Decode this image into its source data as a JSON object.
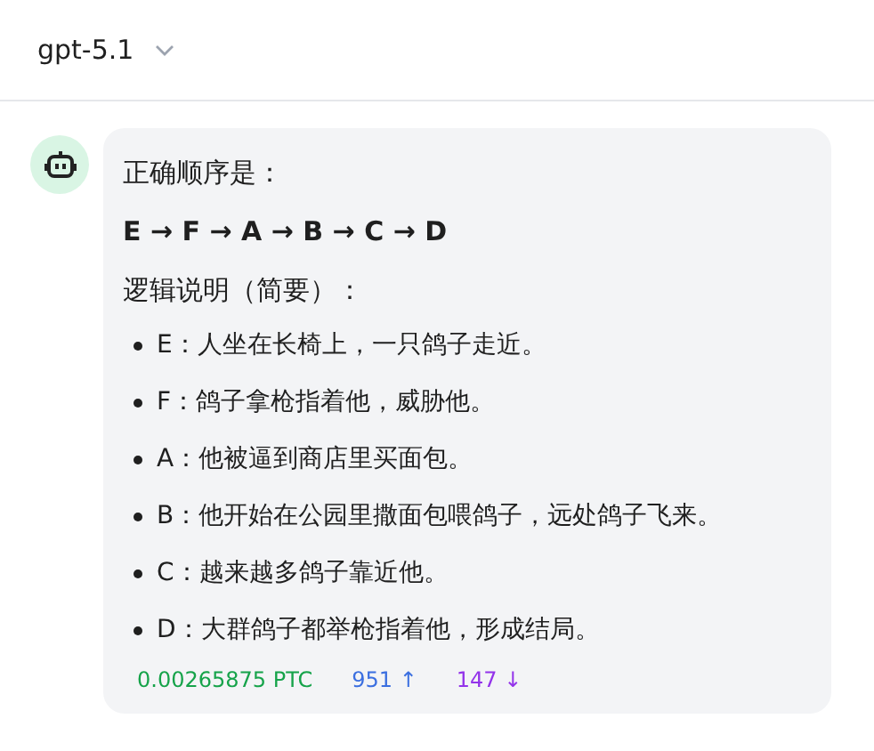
{
  "header": {
    "model": "gpt-5.1"
  },
  "message": {
    "intro": "正确顺序是：",
    "sequence": "E → F → A → B → C → D",
    "heading": "逻辑说明（简要）：",
    "items": [
      "E：人坐在长椅上，一只鸽子走近。",
      "F：鸽子拿枪指着他，威胁他。",
      "A：他被逼到商店里买面包。",
      "B：他开始在公园里撒面包喂鸽子，远处鸽子飞来。",
      "C：越来越多鸽子靠近他。",
      "D：大群鸽子都举枪指着他，形成结局。"
    ],
    "stats": {
      "cost": "0.00265875 PTC",
      "input_tokens": "951 ↑",
      "output_tokens": "147 ↓"
    }
  }
}
